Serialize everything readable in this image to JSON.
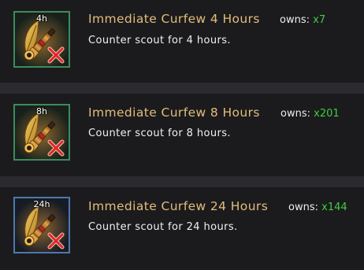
{
  "items": [
    {
      "duration_badge": "4h",
      "title": "Immediate Curfew 4 Hours",
      "owns_label": "owns:",
      "owns_count": "x7",
      "description": "Counter scout for 4 hours."
    },
    {
      "duration_badge": "8h",
      "title": "Immediate Curfew 8 Hours",
      "owns_label": "owns:",
      "owns_count": "x201",
      "description": "Counter scout for 8 hours."
    },
    {
      "duration_badge": "24h",
      "title": "Immediate Curfew 24 Hours",
      "owns_label": "owns:",
      "owns_count": "x144",
      "description": "Counter scout for 24 hours."
    }
  ],
  "colors": {
    "title": "#e3bd7a",
    "owns_count": "#3fcd3f",
    "frame_green": "#3f8a5c",
    "frame_blue": "#4f78ad"
  },
  "icon": "curfew-telescope-feather-icon"
}
